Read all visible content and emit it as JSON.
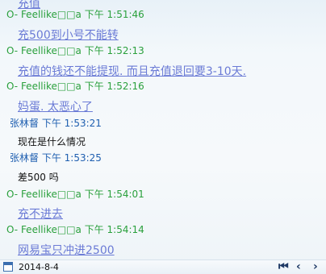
{
  "messages": [
    {
      "type": "link",
      "text": "充值"
    },
    {
      "type": "header",
      "who": "self",
      "prefix": "O-",
      "sender": "Feellike□□а",
      "time": "下午 1:51:46"
    },
    {
      "type": "link",
      "text": "充500到小号不能转"
    },
    {
      "type": "header",
      "who": "self",
      "prefix": "O-",
      "sender": "Feellike□□а",
      "time": "下午 1:52:13"
    },
    {
      "type": "link",
      "text": "充值的钱还不能提现. 而且充值退回要3-10天."
    },
    {
      "type": "header",
      "who": "self",
      "prefix": "O-",
      "sender": "Feellike□□а",
      "time": "下午 1:52:16"
    },
    {
      "type": "link",
      "text": "妈蛋. 太恶心了"
    },
    {
      "type": "header",
      "who": "other",
      "prefix": "",
      "sender": "张林督",
      "time": "下午 1:53:21"
    },
    {
      "type": "plain",
      "text": "现在是什么情况"
    },
    {
      "type": "header",
      "who": "other",
      "prefix": "",
      "sender": "张林督",
      "time": "下午 1:53:25"
    },
    {
      "type": "plain",
      "text": "差500 吗"
    },
    {
      "type": "header",
      "who": "self",
      "prefix": "O-",
      "sender": "Feellike□□а",
      "time": "下午 1:54:01"
    },
    {
      "type": "link",
      "text": "充不进去"
    },
    {
      "type": "header",
      "who": "self",
      "prefix": "O-",
      "sender": "Feellike□□а",
      "time": "下午 1:54:14"
    },
    {
      "type": "link",
      "text": "网易宝只冲进2500"
    }
  ],
  "footer": {
    "date": "2014-8-4",
    "calendar_icon": "calendar-icon",
    "first_icon": "⏮",
    "prev_icon": "‹",
    "next_icon": "›"
  },
  "colors": {
    "self_header": "#2aa03c",
    "other_header": "#1f5fb0",
    "link_message": "#6b7bd6"
  }
}
